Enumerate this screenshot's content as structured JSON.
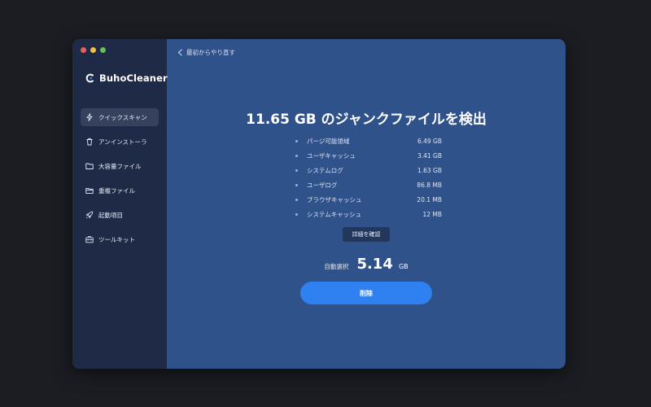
{
  "app": {
    "name": "BuhoCleaner"
  },
  "sidebar": {
    "items": [
      {
        "label": "クイックスキャン",
        "icon": "lightning-icon",
        "active": true
      },
      {
        "label": "アンインストーラ",
        "icon": "trash-icon",
        "active": false
      },
      {
        "label": "大容量ファイル",
        "icon": "folder-icon",
        "active": false
      },
      {
        "label": "重複ファイル",
        "icon": "folder-duplicate-icon",
        "active": false
      },
      {
        "label": "起動項目",
        "icon": "rocket-icon",
        "active": false
      },
      {
        "label": "ツールキット",
        "icon": "toolbox-icon",
        "active": false
      }
    ]
  },
  "main": {
    "back_label": "最初からやり直す",
    "headline": "11.65 GB のジャンクファイルを検出",
    "junk_items": [
      {
        "name": "パージ可能領域",
        "size": "6.49 GB"
      },
      {
        "name": "ユーザキャッシュ",
        "size": "3.41 GB"
      },
      {
        "name": "システムログ",
        "size": "1.63 GB"
      },
      {
        "name": "ユーザログ",
        "size": "86.8 MB"
      },
      {
        "name": "ブラウザキャッシュ",
        "size": "20.1 MB"
      },
      {
        "name": "システムキャッシュ",
        "size": "12 MB"
      }
    ],
    "details_button": "詳細を確認",
    "auto_select_label": "自動選択",
    "auto_select_value": "5.14",
    "auto_select_unit": "GB",
    "delete_button": "削除"
  },
  "colors": {
    "main_bg": "#30528a",
    "sidebar_bg": "#1f2a47",
    "accent": "#2f80f0"
  }
}
